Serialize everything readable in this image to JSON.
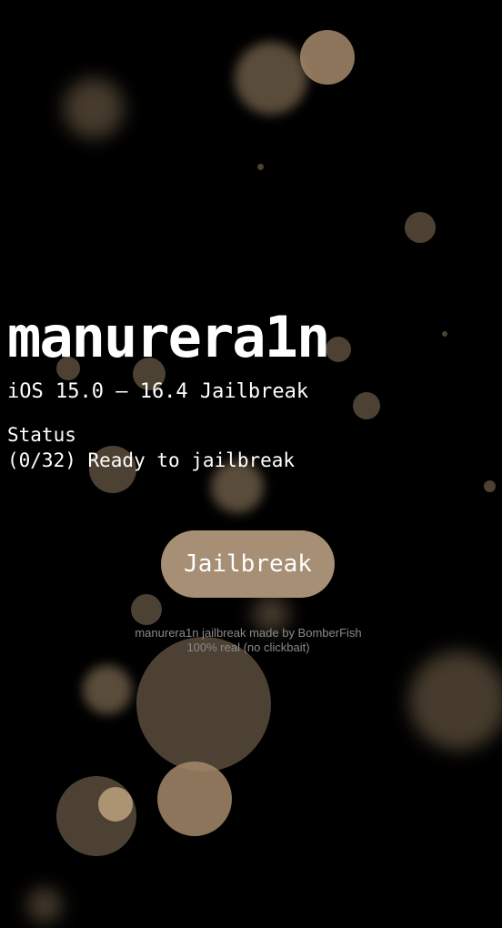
{
  "app": {
    "title": "manurera1n",
    "subtitle": "iOS 15.0 – 16.4 Jailbreak"
  },
  "status": {
    "label": "Status",
    "progress_text": "(0/32) Ready to jailbreak",
    "steps_done": 0,
    "steps_total": 32
  },
  "actions": {
    "jailbreak_label": "Jailbreak"
  },
  "footer": {
    "credit_line": "manurera1n jailbreak made by BomberFish",
    "tagline": "100% real (no clickbait)"
  },
  "theme": {
    "background": "#000000",
    "accent": "#a68f74",
    "text": "#ffffff",
    "footer_text": "#8a8a8a"
  }
}
